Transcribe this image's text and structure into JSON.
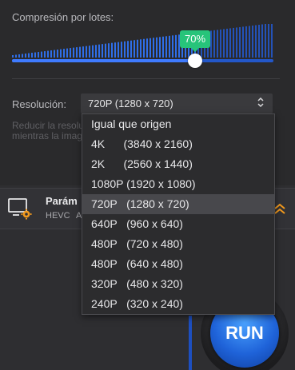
{
  "compression": {
    "label": "Compresión por lotes:",
    "percent_label": "70%",
    "percent": 70
  },
  "resolution": {
    "label": "Resolución:",
    "selected": "720P   (1280 x 720)",
    "hint_line1": "Reducir la resolu",
    "hint_line2": "mientras la imag",
    "options": [
      "Igual que origen",
      "4K      (3840 x 2160)",
      "2K      (2560 x 1440)",
      "1080P (1920 x 1080)",
      "720P   (1280 x 720)",
      "640P   (960 x 640)",
      "480P   (720 x 480)",
      "480P   (640 x 480)",
      "320P   (480 x 320)",
      "240P   (320 x 240)"
    ],
    "selected_index": 4
  },
  "parameters": {
    "title": "Parám",
    "codec": "HEVC",
    "codec_extra": "A",
    "icon": "monitor-gear-icon"
  },
  "run": {
    "label": "RUN"
  },
  "colors": {
    "accent": "#3f7bff",
    "tooltip": "#27c47a",
    "gear": "#f39a1e"
  }
}
